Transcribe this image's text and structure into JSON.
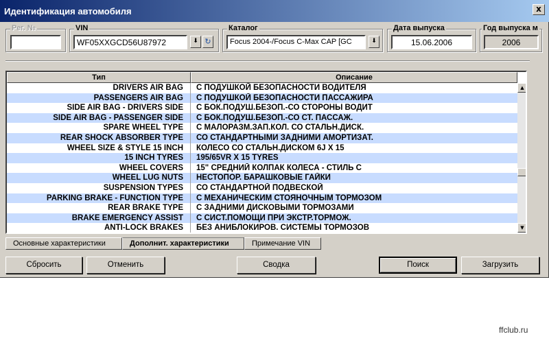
{
  "window": {
    "title": "Идентификация автомобиля",
    "close_label": "x"
  },
  "reg_no": {
    "label": "Рег. №",
    "value": ""
  },
  "vin": {
    "label": "VIN",
    "value": "WF05XXGCD56U87972",
    "dropdown_icon": "save-down-icon",
    "refresh_icon": "refresh-icon"
  },
  "catalog": {
    "label": "Каталог",
    "value": "Focus 2004-/Focus C-Max CAP [GC",
    "dropdown_icon": "save-down-icon"
  },
  "release_date": {
    "label": "Дата выпуска",
    "value": "15.06.2006"
  },
  "release_year": {
    "label": "Год выпуска м",
    "value": "2006"
  },
  "grid": {
    "headers": [
      "Тип",
      "Описание"
    ],
    "rows": [
      [
        "DRIVERS AIR BAG",
        "С ПОДУШКОЙ БЕЗОПАСНОСТИ ВОДИТЕЛЯ"
      ],
      [
        "PASSENGERS AIR BAG",
        "С ПОДУШКОЙ БЕЗОПАСНОСТИ ПАССАЖИРА"
      ],
      [
        "SIDE AIR BAG - DRIVERS SIDE",
        "С БОК.ПОДУШ.БЕЗОП.-СО СТОРОНЫ ВОДИТ"
      ],
      [
        "SIDE AIR BAG - PASSENGER SIDE",
        "С БОК.ПОДУШ.БЕЗОП.-СО СТ. ПАССАЖ."
      ],
      [
        "SPARE WHEEL TYPE",
        "С МАЛОРАЗМ.ЗАП.КОЛ. СО СТАЛЬН.ДИСК."
      ],
      [
        "REAR SHOCK ABSORBER TYPE",
        "СО СТАНДАРТНЫМИ ЗАДНИМИ АМОРТИЗАТ."
      ],
      [
        "WHEEL SIZE & STYLE 15 INCH",
        "КОЛЕСО СО СТАЛЬН.ДИСКОМ 6J X 15"
      ],
      [
        "15 INCH TYRES",
        "195/65VR X 15 TYRES"
      ],
      [
        "WHEEL COVERS",
        "15\" СРЕДНИЙ КОЛПАК КОЛЕСА - СТИЛЬ С"
      ],
      [
        "WHEEL LUG NUTS",
        "НЕСТОПОР. БАРАШКОВЫЕ ГАЙКИ"
      ],
      [
        "SUSPENSION TYPES",
        "СО СТАНДАРТНОЙ ПОДВЕСКОЙ"
      ],
      [
        "PARKING BRAKE - FUNCTION TYPE",
        "С МЕХАНИЧЕСКИМ СТОЯНОЧНЫМ ТОРМОЗОМ"
      ],
      [
        "REAR BRAKE TYPE",
        "С ЗАДНИМИ ДИСКОВЫМИ ТОРМОЗАМИ"
      ],
      [
        "BRAKE EMERGENCY ASSIST",
        "С СИСТ.ПОМОЩИ ПРИ ЭКСТР.ТОРМОЖ."
      ],
      [
        "ANTI-LOCK BRAKES",
        "БЕЗ АНИБЛОКИРОВ. СИСТЕМЫ ТОРМОЗОВ"
      ]
    ],
    "scroll_position": 0.62
  },
  "tabs": [
    {
      "label": "Основные характеристики",
      "active": false
    },
    {
      "label": "Дополнит. характеристики",
      "active": true
    },
    {
      "label": "Примечание VIN",
      "active": false
    }
  ],
  "buttons": {
    "reset": "Сбросить",
    "cancel": "Отменить",
    "summary": "Сводка",
    "search": "Поиск",
    "load": "Загрузить"
  },
  "watermark": "ffclub.ru"
}
